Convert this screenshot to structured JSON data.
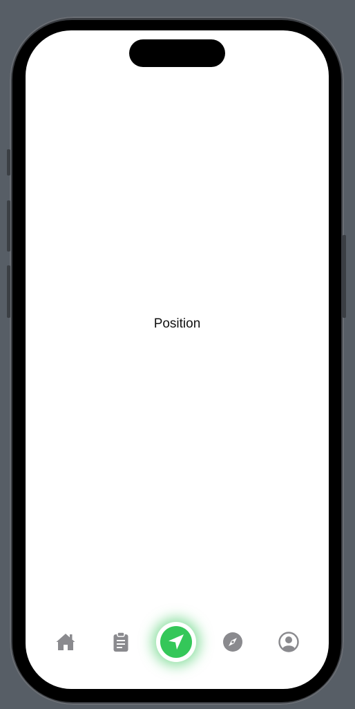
{
  "screen": {
    "label": "Position"
  },
  "tab_bar": {
    "items": [
      {
        "icon": "house-icon"
      },
      {
        "icon": "clipboard-icon"
      },
      {
        "icon": "location-arrow-icon"
      },
      {
        "icon": "compass-icon"
      },
      {
        "icon": "person-circle-icon"
      }
    ],
    "active_index": 2
  },
  "colors": {
    "accent": "#34c759",
    "icon_inactive": "#8a8a8e",
    "background": "#ffffff",
    "desktop": "#575e66"
  }
}
